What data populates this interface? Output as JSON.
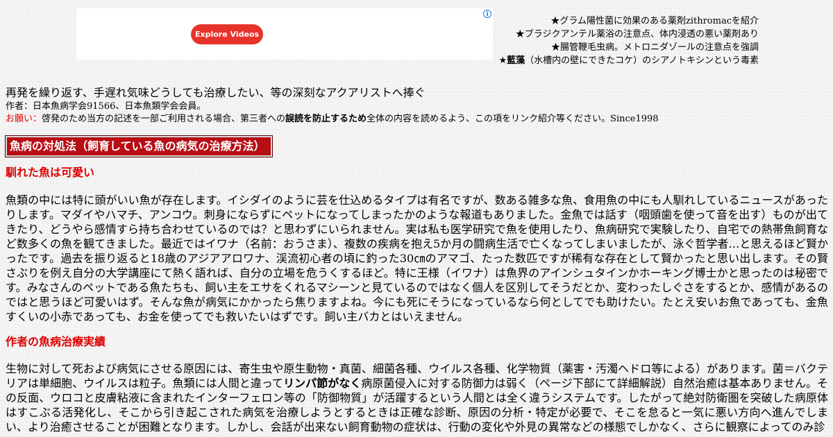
{
  "ad": {
    "button_label": "Explore Videos",
    "info_icon": "info-icon",
    "button_color": "#e8332a"
  },
  "top_links": [
    {
      "prefix": "★",
      "bold": "",
      "text": "グラム陽性菌に効果のある薬剤zithromacを紹介"
    },
    {
      "prefix": "★",
      "bold": "",
      "text": "ブラジクアンテル薬浴の注意点、体内浸透の悪い薬剤あり"
    },
    {
      "prefix": "★",
      "bold": "",
      "text": "腸管鞭毛虫病。メトロニダゾールの注意点を強調"
    },
    {
      "prefix": "★",
      "bold": "藍藻",
      "text": "（水槽内の壁にできたコケ）のシアノトキシンという毒素"
    }
  ],
  "intro": {
    "dedication": "再発を繰り返す、手遅れ気味どうしても治療したい、等の深刻なアクアリストへ捧ぐ",
    "author": "作者：日本魚病学会91566、日本魚類学会会員。",
    "request_label": "お願い：",
    "request_text_1": "啓発のため当方の記述を一部ご利用される場合、第三者への",
    "request_bold": "誤読を防止するため",
    "request_text_2": "全体の内容を読めるよう、この項をリンク紹介等ください。Since1998"
  },
  "title_banner": "魚病の対処法（飼育している魚の病気の治療方法）",
  "sections": [
    {
      "heading": "馴れた魚は可愛い",
      "body": "魚類の中には特に頭がいい魚が存在します。イシダイのように芸を仕込めるタイプは有名ですが、数ある雑多な魚、食用魚の中にも人馴れしているニュースがあったりします。マダイやハマチ、アンコウ。刺身にならずにペットになってしまったかのような報道もありました。金魚では話す（咽頭歯を使って音を出す）ものが出てきたり、どうやら感情すら持ち合わせているのでは？と思わずにいられません。実は私も医学研究で魚を使用したり、魚病研究で実験したり、自宅での熱帯魚飼育など数多くの魚を観てきました。最近ではイワナ（名前：おうさま）、複数の疾病を抱え5か月の闘病生活で亡くなってしまいましたが、泳ぐ哲学者…と思えるほど賢かったです。過去を振り返ると18歳のアジアアロワナ、渓流初心者の頃に釣った30㎝のアマゴ、たった数匹ですが稀有な存在として賢かったと思い出します。その賢さぶりを例え自分の大学講座にて熱く語れば、自分の立場を危うくするほど。特に王様（イワナ）は魚界のアインシュタインかホーキング博士かと思ったのは秘密です。みなさんのペットである魚たちも、飼い主をエサをくれるマシーンと見ているのではなく個人を区別してそうだとか、変わったしぐさをするとか、感情があるのではと思うほど可愛いはず。そんな魚が病気にかかったら焦りますよね。今にも死にそうになっているなら何としてでも助けたい。たとえ安いお魚であっても、金魚すくいの小赤であっても、お金を使ってでも救いたいはずです。飼い主バカとはいえません。"
    },
    {
      "heading": "作者の魚病治療実績",
      "body_1": "生物に対して死および病気にさせる原因には、寄生虫や原生動物・真菌、細菌各種、ウイルス各種、化学物質（薬害・汚濁ヘドロ等による）があります。菌＝バクテリアは単細胞、ウイルスは粒子。魚類には人間と違って",
      "body_bold": "リンパ節がなく",
      "body_2": "病原菌侵入に対する防御力は弱く（ページ下部にて詳細解説）自然治癒は基本ありません。その反面、ウロコと皮膚粘液に含まれたインターフェロン等の「防御物質」が活躍するという人間とは全く違うシステムです。したがって絶対防衛圏を突破した病原体はすこぶる活発化し、そこから引き起こされた病気を治療しようとするときは正確な診断、原因の分析・特定が必要で、そこを怠ると一気に悪い方向へ進んでしまい、より治癒させることが困難となります。しかし、会話が出来ない飼育動物の症状は、行動の変化や外見の異常などの様態でしかなく、さらに観察によってのみ診"
    }
  ]
}
